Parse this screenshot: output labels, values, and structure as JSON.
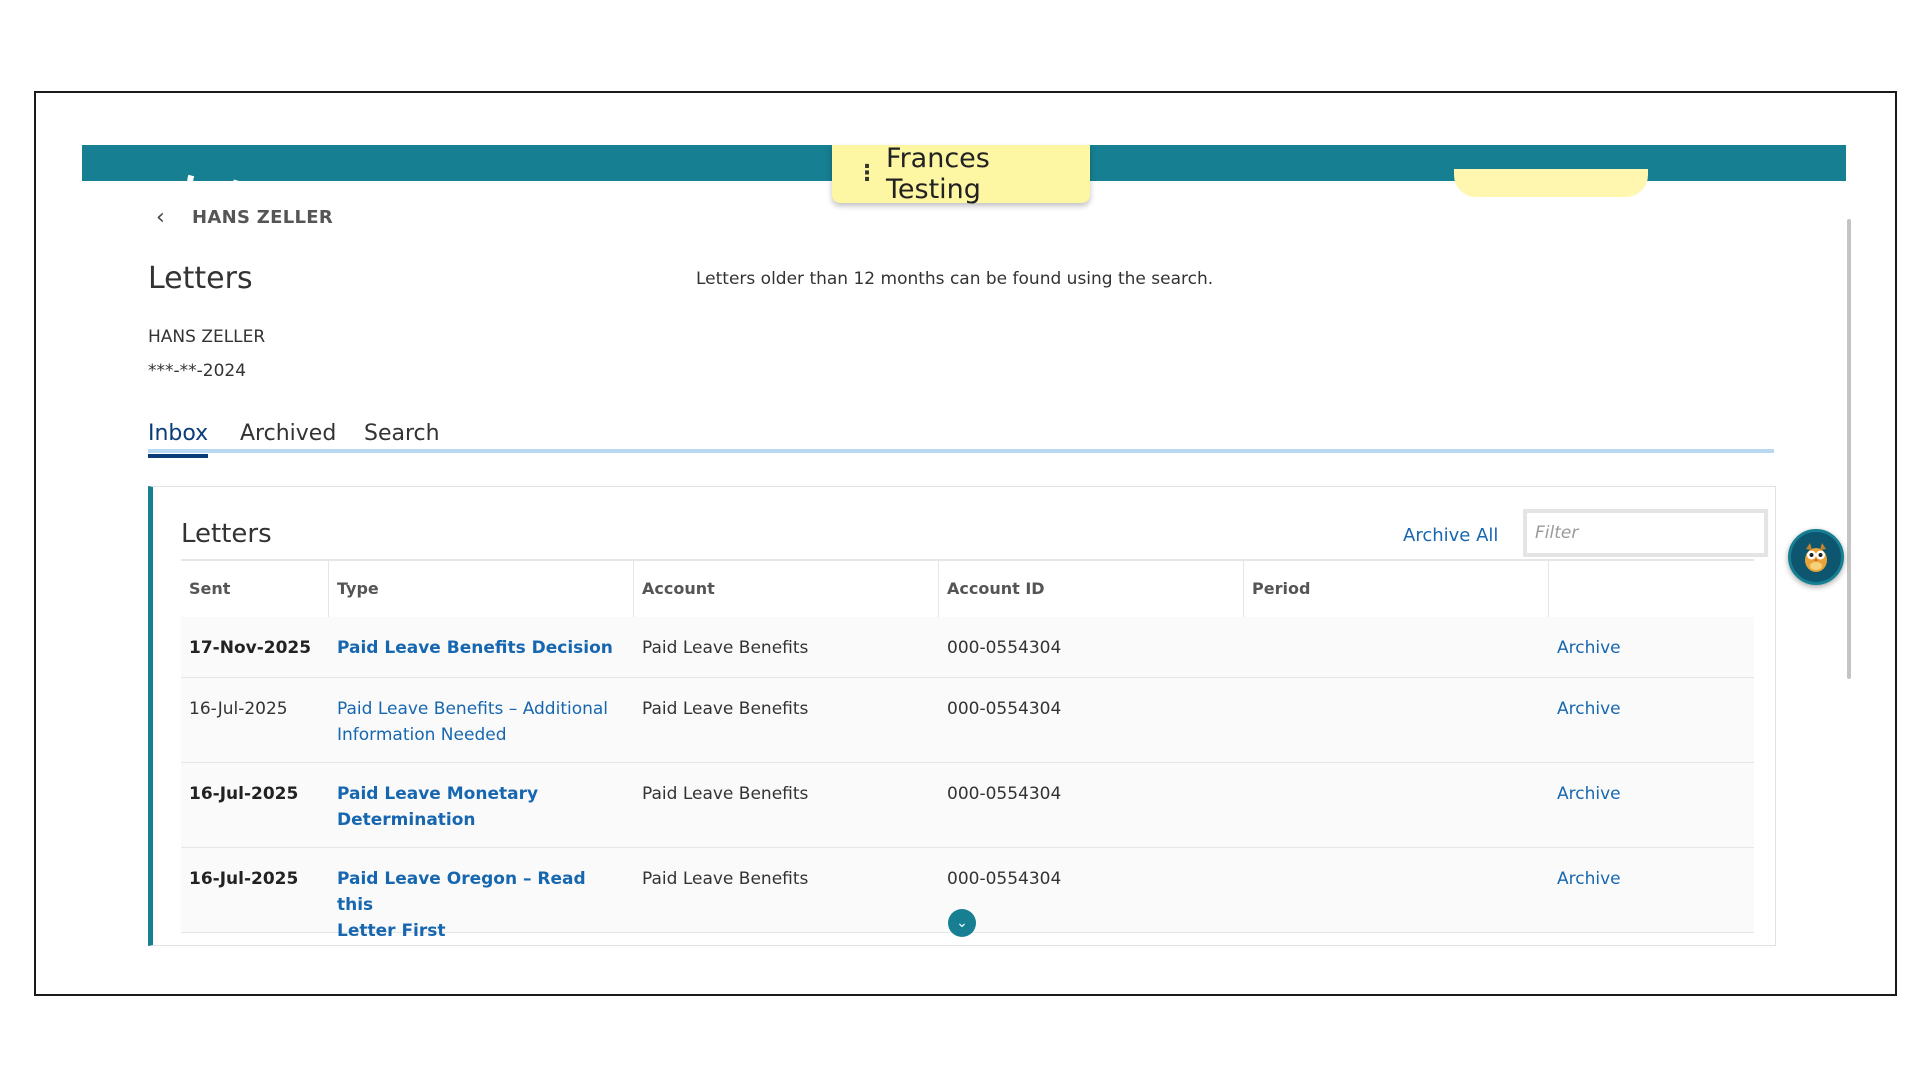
{
  "header": {
    "tester_name": "Frances Testing"
  },
  "breadcrumb": {
    "back_label": "HANS ZELLER"
  },
  "page": {
    "title": "Letters",
    "notice": "Letters older than 12 months can be found using the search.",
    "person_name": "HANS ZELLER",
    "person_ssn": "***-**-2024"
  },
  "tabs": [
    {
      "label": "Inbox",
      "active": true
    },
    {
      "label": "Archived",
      "active": false
    },
    {
      "label": "Search",
      "active": false
    }
  ],
  "card": {
    "title": "Letters",
    "archive_all_label": "Archive All",
    "filter_placeholder": "Filter"
  },
  "table": {
    "headers": [
      "Sent",
      "Type",
      "Account",
      "Account ID",
      "Period",
      ""
    ],
    "rows": [
      {
        "sent": "17-Nov-2025",
        "type_line1": "Paid Leave Benefits Decision",
        "type_line2": "",
        "account": "Paid Leave Benefits",
        "account_id": "000-0554304",
        "period": "",
        "action": "Archive",
        "unread": true
      },
      {
        "sent": "16-Jul-2025",
        "type_line1": "Paid Leave Benefits – Additional",
        "type_line2": "Information Needed",
        "account": "Paid Leave Benefits",
        "account_id": "000-0554304",
        "period": "",
        "action": "Archive",
        "unread": false
      },
      {
        "sent": "16-Jul-2025",
        "type_line1": "Paid Leave Monetary",
        "type_line2": "Determination",
        "account": "Paid Leave Benefits",
        "account_id": "000-0554304",
        "period": "",
        "action": "Archive",
        "unread": true
      },
      {
        "sent": "16-Jul-2025",
        "type_line1": "Paid Leave Oregon – Read this",
        "type_line2": "Letter First",
        "account": "Paid Leave Benefits",
        "account_id": "000-0554304",
        "period": "",
        "action": "Archive",
        "unread": true
      }
    ]
  },
  "colors": {
    "header_teal": "#167f91",
    "link_blue": "#1767b0",
    "active_tab": "#0a3c7a",
    "tester_tab_bg": "#fdf6a3"
  },
  "icons": {
    "back": "chevron-left-icon",
    "menu": "kebab-menu-icon",
    "scroll": "chevron-down-icon",
    "assistant": "owl-icon"
  }
}
